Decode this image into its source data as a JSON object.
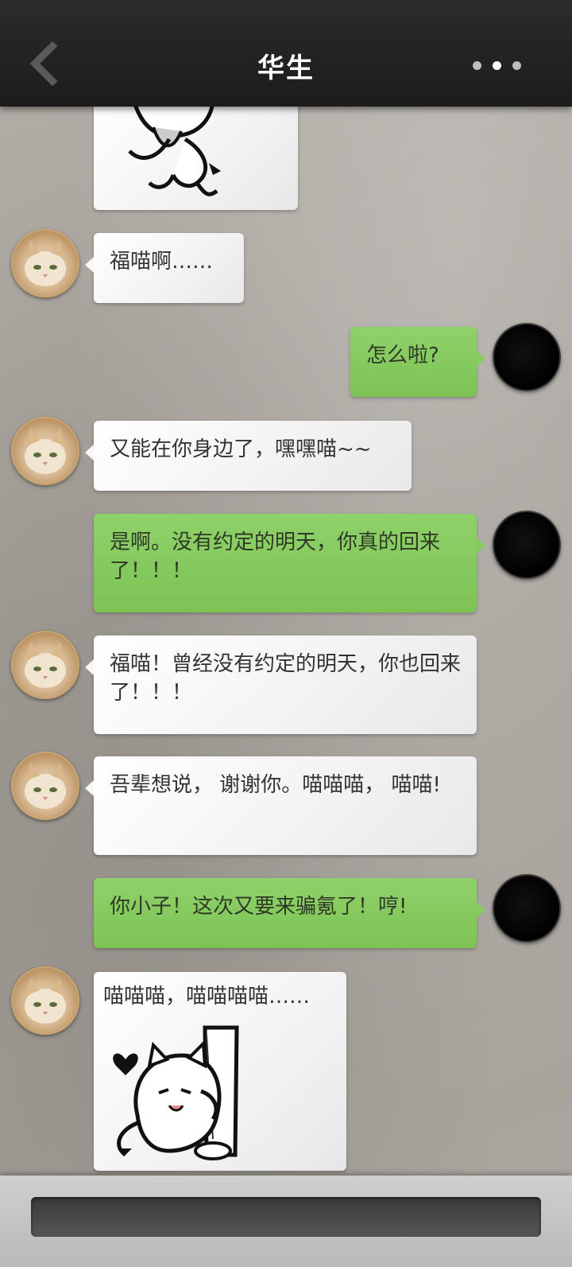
{
  "header": {
    "title": "华生"
  },
  "messages": [
    {
      "id": 1,
      "side": "received",
      "type": "sticker",
      "caption": ""
    },
    {
      "id": 2,
      "side": "received",
      "type": "text",
      "text": "福喵啊……"
    },
    {
      "id": 3,
      "side": "sent",
      "type": "text",
      "text": "怎么啦?"
    },
    {
      "id": 4,
      "side": "received",
      "type": "text",
      "text": "又能在你身边了，嘿嘿喵~~"
    },
    {
      "id": 5,
      "side": "sent",
      "type": "text",
      "text": "是啊。没有约定的明天，你真的回来了！！！"
    },
    {
      "id": 6,
      "side": "received",
      "type": "text",
      "text": "福喵！曾经没有约定的明天，你也回来了！！！"
    },
    {
      "id": 7,
      "side": "received",
      "type": "text",
      "text": "吾辈想说， 谢谢你。喵喵喵， 喵喵!"
    },
    {
      "id": 8,
      "side": "sent",
      "type": "text",
      "text": "你小子！这次又要来骗氪了！哼!"
    },
    {
      "id": 9,
      "side": "received",
      "type": "sticker",
      "caption": "喵喵喵，喵喵喵喵……"
    }
  ],
  "icons": {
    "back": "chevron-left-icon",
    "more": "more-dots-icon"
  },
  "colors": {
    "header_bg": "#1f1f1f",
    "sent_bubble": "#86cb60",
    "received_bubble": "#f5f5f5",
    "input_field": "#444444"
  }
}
